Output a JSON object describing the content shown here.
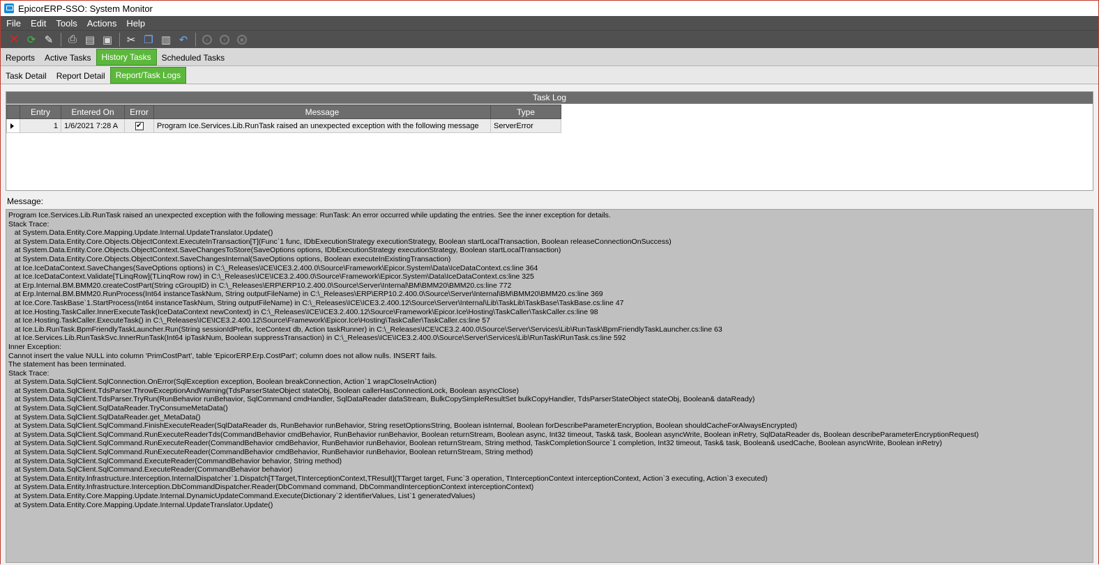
{
  "window": {
    "title": "EpicorERP-SSO: System Monitor"
  },
  "menu": {
    "items": [
      "File",
      "Edit",
      "Tools",
      "Actions",
      "Help"
    ]
  },
  "toolbar": {
    "buttons": [
      "delete-icon",
      "refresh-icon",
      "eraser-icon",
      "print-icon",
      "print-preview-icon",
      "save-icon",
      "cut-icon",
      "copy-icon",
      "paste-icon",
      "undo-icon",
      "back-icon",
      "forward-icon",
      "stop-icon"
    ]
  },
  "tabs": {
    "main": [
      "Reports",
      "Active Tasks",
      "History Tasks",
      "Scheduled Tasks"
    ],
    "main_active": "History Tasks",
    "sub": [
      "Task Detail",
      "Report Detail",
      "Report/Task Logs"
    ],
    "sub_active": "Report/Task Logs"
  },
  "task_log": {
    "caption": "Task Log",
    "columns": [
      "Entry",
      "Entered On",
      "Error",
      "Message",
      "Type"
    ],
    "rows": [
      {
        "entry": "1",
        "entered_on": "1/6/2021 7:28 A",
        "error": true,
        "message": "Program Ice.Services.Lib.RunTask raised an unexpected exception with the following message",
        "type": "ServerError"
      }
    ]
  },
  "message": {
    "label": "Message:",
    "lines": [
      "Program Ice.Services.Lib.RunTask raised an unexpected exception with the following message: RunTask: An error occurred while updating the entries. See the inner exception for details.",
      "Stack Trace:",
      "   at System.Data.Entity.Core.Mapping.Update.Internal.UpdateTranslator.Update()",
      "   at System.Data.Entity.Core.Objects.ObjectContext.ExecuteInTransaction[T](Func`1 func, IDbExecutionStrategy executionStrategy, Boolean startLocalTransaction, Boolean releaseConnectionOnSuccess)",
      "   at System.Data.Entity.Core.Objects.ObjectContext.SaveChangesToStore(SaveOptions options, IDbExecutionStrategy executionStrategy, Boolean startLocalTransaction)",
      "   at System.Data.Entity.Core.Objects.ObjectContext.SaveChangesInternal(SaveOptions options, Boolean executeInExistingTransaction)",
      "   at Ice.IceDataContext.SaveChanges(SaveOptions options) in C:\\_Releases\\ICE\\ICE3.2.400.0\\Source\\Framework\\Epicor.System\\Data\\IceDataContext.cs:line 364",
      "   at Ice.IceDataContext.Validate[TLinqRow](TLinqRow row) in C:\\_Releases\\ICE\\ICE3.2.400.0\\Source\\Framework\\Epicor.System\\Data\\IceDataContext.cs:line 325",
      "   at Erp.Internal.BM.BMM20.createCostPart(String cGroupID) in C:\\_Releases\\ERP\\ERP10.2.400.0\\Source\\Server\\Internal\\BM\\BMM20\\BMM20.cs:line 772",
      "   at Erp.Internal.BM.BMM20.RunProcess(Int64 instanceTaskNum, String outputFileName) in C:\\_Releases\\ERP\\ERP10.2.400.0\\Source\\Server\\Internal\\BM\\BMM20\\BMM20.cs:line 369",
      "   at Ice.Core.TaskBase`1.StartProcess(Int64 instanceTaskNum, String outputFileName) in C:\\_Releases\\ICE\\ICE3.2.400.12\\Source\\Server\\Internal\\Lib\\TaskLib\\TaskBase\\TaskBase.cs:line 47",
      "   at Ice.Hosting.TaskCaller.InnerExecuteTask(IceDataContext newContext) in C:\\_Releases\\ICE\\ICE3.2.400.12\\Source\\Framework\\Epicor.Ice\\Hosting\\TaskCaller\\TaskCaller.cs:line 98",
      "   at Ice.Hosting.TaskCaller.ExecuteTask() in C:\\_Releases\\ICE\\ICE3.2.400.12\\Source\\Framework\\Epicor.Ice\\Hosting\\TaskCaller\\TaskCaller.cs:line 57",
      "   at Ice.Lib.RunTask.BpmFriendlyTaskLauncher.Run(String sessionIdPrefix, IceContext db, Action taskRunner) in C:\\_Releases\\ICE\\ICE3.2.400.0\\Source\\Server\\Services\\Lib\\RunTask\\BpmFriendlyTaskLauncher.cs:line 63",
      "   at Ice.Services.Lib.RunTaskSvc.InnerRunTask(Int64 ipTaskNum, Boolean suppressTransaction) in C:\\_Releases\\ICE\\ICE3.2.400.0\\Source\\Server\\Services\\Lib\\RunTask\\RunTask.cs:line 592",
      "Inner Exception:",
      "Cannot insert the value NULL into column 'PrimCostPart', table 'EpicorERP.Erp.CostPart'; column does not allow nulls. INSERT fails.",
      "The statement has been terminated.",
      "Stack Trace:",
      "   at System.Data.SqlClient.SqlConnection.OnError(SqlException exception, Boolean breakConnection, Action`1 wrapCloseInAction)",
      "   at System.Data.SqlClient.TdsParser.ThrowExceptionAndWarning(TdsParserStateObject stateObj, Boolean callerHasConnectionLock, Boolean asyncClose)",
      "   at System.Data.SqlClient.TdsParser.TryRun(RunBehavior runBehavior, SqlCommand cmdHandler, SqlDataReader dataStream, BulkCopySimpleResultSet bulkCopyHandler, TdsParserStateObject stateObj, Boolean& dataReady)",
      "   at System.Data.SqlClient.SqlDataReader.TryConsumeMetaData()",
      "   at System.Data.SqlClient.SqlDataReader.get_MetaData()",
      "   at System.Data.SqlClient.SqlCommand.FinishExecuteReader(SqlDataReader ds, RunBehavior runBehavior, String resetOptionsString, Boolean isInternal, Boolean forDescribeParameterEncryption, Boolean shouldCacheForAlwaysEncrypted)",
      "   at System.Data.SqlClient.SqlCommand.RunExecuteReaderTds(CommandBehavior cmdBehavior, RunBehavior runBehavior, Boolean returnStream, Boolean async, Int32 timeout, Task& task, Boolean asyncWrite, Boolean inRetry, SqlDataReader ds, Boolean describeParameterEncryptionRequest)",
      "   at System.Data.SqlClient.SqlCommand.RunExecuteReader(CommandBehavior cmdBehavior, RunBehavior runBehavior, Boolean returnStream, String method, TaskCompletionSource`1 completion, Int32 timeout, Task& task, Boolean& usedCache, Boolean asyncWrite, Boolean inRetry)",
      "   at System.Data.SqlClient.SqlCommand.RunExecuteReader(CommandBehavior cmdBehavior, RunBehavior runBehavior, Boolean returnStream, String method)",
      "   at System.Data.SqlClient.SqlCommand.ExecuteReader(CommandBehavior behavior, String method)",
      "   at System.Data.SqlClient.SqlCommand.ExecuteReader(CommandBehavior behavior)",
      "   at System.Data.Entity.Infrastructure.Interception.InternalDispatcher`1.Dispatch[TTarget,TInterceptionContext,TResult](TTarget target, Func`3 operation, TInterceptionContext interceptionContext, Action`3 executing, Action`3 executed)",
      "   at System.Data.Entity.Infrastructure.Interception.DbCommandDispatcher.Reader(DbCommand command, DbCommandInterceptionContext interceptionContext)",
      "   at System.Data.Entity.Core.Mapping.Update.Internal.DynamicUpdateCommand.Execute(Dictionary`2 identifierValues, List`1 generatedValues)",
      "   at System.Data.Entity.Core.Mapping.Update.Internal.UpdateTranslator.Update()"
    ]
  }
}
